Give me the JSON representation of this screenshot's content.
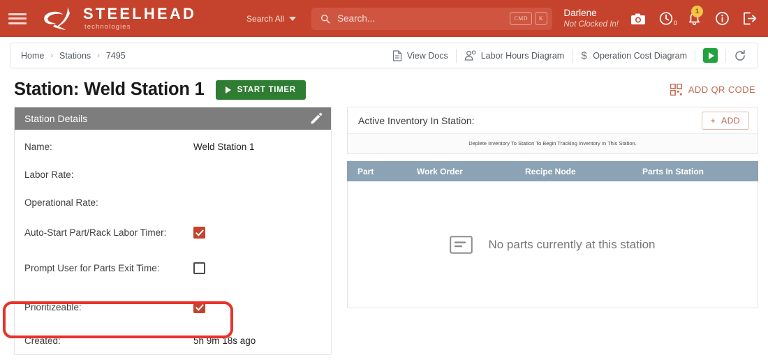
{
  "header": {
    "menu_icon": "hamburger-menu-icon",
    "brand_name": "STEELHEAD",
    "brand_sub": "technologies",
    "search_scope_label": "Search All",
    "search_placeholder": "Search...",
    "kbd_cmd": "CMD",
    "kbd_key": "K",
    "user_name": "Darlene",
    "user_status": "Not Clocked In!",
    "clock_count": "0",
    "notification_count": "1",
    "accent_color": "#c5432c"
  },
  "breadcrumb": {
    "items": [
      "Home",
      "Stations",
      "7495"
    ],
    "separator": "›"
  },
  "toolbar": {
    "view_docs": "View Docs",
    "labor_hours": "Labor Hours Diagram",
    "operation_cost": "Operation Cost Diagram",
    "play_label": "",
    "refresh_label": ""
  },
  "page": {
    "title": "Station: Weld Station 1",
    "start_timer_label": "START TIMER",
    "add_qr_label": "ADD QR CODE"
  },
  "station_details": {
    "card_title": "Station Details",
    "rows": [
      {
        "label": "Name:",
        "value": "Weld Station 1",
        "type": "text"
      },
      {
        "label": "Labor Rate:",
        "value": "",
        "type": "text"
      },
      {
        "label": "Operational Rate:",
        "value": "",
        "type": "text"
      },
      {
        "label": "Auto-Start Part/Rack Labor Timer:",
        "value": "checked",
        "type": "checkbox"
      },
      {
        "label": "Prompt User for Parts Exit Time:",
        "value": "unchecked",
        "type": "checkbox"
      },
      {
        "label": "Prioritizeable:",
        "value": "checked",
        "type": "checkbox"
      },
      {
        "label": "Created:",
        "value": "5h 9m 18s ago",
        "type": "text"
      }
    ]
  },
  "inventory": {
    "title": "Active Inventory In Station:",
    "add_label": "ADD",
    "hint": "Deplete Inventory To Station To Begin Tracking Inventory In This Station.",
    "columns": [
      "Part",
      "Work Order",
      "Recipe Node",
      "Parts In Station"
    ],
    "rows": [],
    "empty_message": "No parts currently at this station"
  },
  "annotation": {
    "highlight_target": "Prioritizeable:",
    "highlight_color": "#e8332a"
  }
}
